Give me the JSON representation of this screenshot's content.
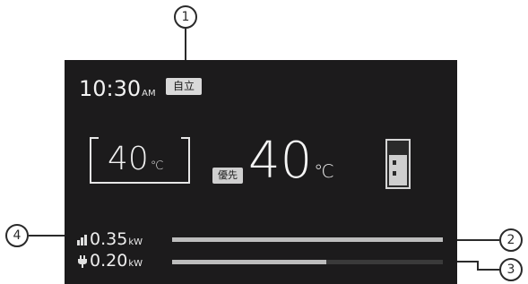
{
  "display": {
    "clock": {
      "time": "10:30",
      "ampm": "AM"
    },
    "mode_badge": "自立",
    "set_temperature": {
      "value": "40",
      "unit": "℃"
    },
    "priority_badge": "優先",
    "current_temperature": {
      "value": "40",
      "unit": "℃"
    },
    "tank_level": 0.7,
    "generation": {
      "value": "0.35",
      "unit": "kW",
      "icon": "power-generation-icon",
      "level": 1.0
    },
    "consumption": {
      "value": "0.20",
      "unit": "kW",
      "icon": "plug-icon",
      "level": 0.57
    }
  },
  "callouts": [
    "1",
    "2",
    "3",
    "4"
  ],
  "colors": {
    "screen_bg": "#1c1b1c",
    "text": "#f0f0f0",
    "bar_fill": "#bdbdbd",
    "bar_track": "#3a3a3a"
  }
}
